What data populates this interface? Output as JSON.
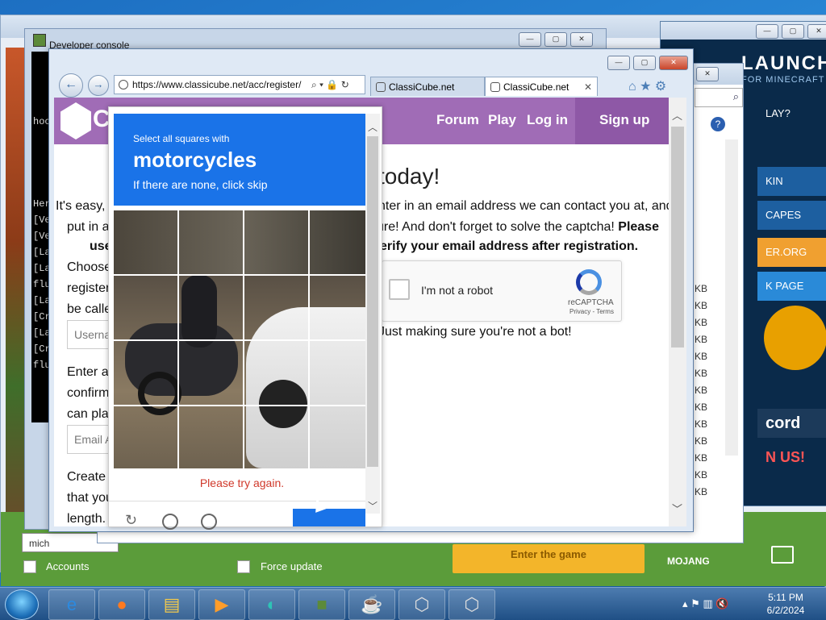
{
  "devconsole": {
    "title": "Developer console",
    "lines": [
      "hoc",
      "Her",
      "[Ve",
      "[Ve",
      "[La",
      "[La",
      "flu",
      "[La",
      "[Cr",
      "[La",
      "[Cr",
      "flu"
    ]
  },
  "launcher": {
    "brand": "LAUNCHER",
    "sub": "FOR MINECRAFT",
    "menu": [
      "LAY?",
      "KIN",
      "CAPES",
      "ER.ORG",
      "K PAGE",
      "cord",
      "N US!"
    ],
    "username": "mich",
    "accounts_label": "Accounts",
    "force_update_label": "Force update",
    "play_label": "Enter the game",
    "mojang": "MOJANG"
  },
  "filewin": {
    "sizes": [
      "KB",
      "KB",
      "KB",
      "KB",
      "KB",
      "KB",
      "KB",
      "KB",
      "KB",
      "KB",
      "KB",
      "KB",
      "KB"
    ]
  },
  "browser": {
    "url": "https://www.classicube.net/acc/register/",
    "tabs": [
      {
        "label": "ClassiCube.net"
      },
      {
        "label": "ClassiCube.net"
      }
    ],
    "tab_close": "✕"
  },
  "page": {
    "logo_text": "C",
    "nav": [
      "Forum",
      "Play",
      "Log in"
    ],
    "signup": "Sign up",
    "heading_fragment": "today!",
    "left_text": [
      "It's easy,",
      "put in a",
      "use",
      "Choose",
      "register",
      "be calle"
    ],
    "right_text_1": "nter in an email address we can contact you at, and",
    "right_text_2a": "ure! And don't forget to solve the captcha!",
    "right_text_2b": "Please",
    "right_text_3": "erify your email address after registration.",
    "username_placeholder": "Userna",
    "email_text": [
      "Enter a",
      "confirm",
      "can pla"
    ],
    "email_placeholder": "Email A",
    "password_text": [
      "Create",
      "that you",
      "length."
    ],
    "not_bot": "Just making sure you're not a bot!",
    "recaptcha": {
      "label": "I'm not a robot",
      "brand": "reCAPTCHA",
      "terms": "Privacy - Terms"
    }
  },
  "captcha": {
    "instruction_small": "Select all squares with",
    "target": "motorcycles",
    "instruction_sub": "If there are none, click skip",
    "error": "Please try again."
  },
  "taskbar": {
    "time": "5:11 PM",
    "date": "6/2/2024",
    "items": [
      "ie-icon",
      "firefox-icon",
      "explorer-icon",
      "media-icon",
      "edge-icon",
      "minecraft-icon",
      "java-icon",
      "classicube-icon",
      "classicube-icon"
    ]
  },
  "colors": {
    "classicube_purple": "#a06cb6",
    "recaptcha_blue": "#1a73e8",
    "error_red": "#d0392b",
    "launcher_green": "#5b9c3a"
  }
}
